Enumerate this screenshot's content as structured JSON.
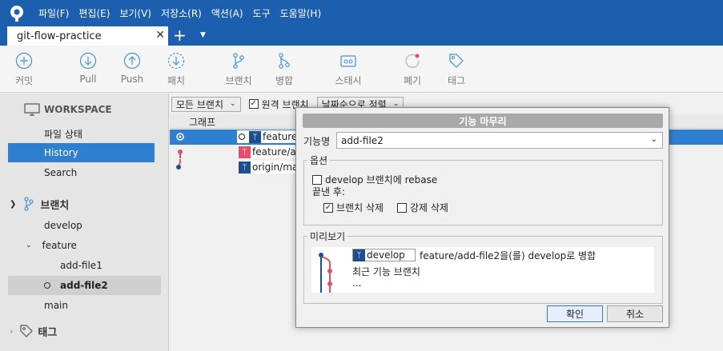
{
  "menu": [
    "파일(F)",
    "편집(E)",
    "보기(V)",
    "저장소(R)",
    "액션(A)",
    "도구",
    "도움말(H)"
  ],
  "tab": {
    "title": "git-flow-practice",
    "close": "✕",
    "add": "+",
    "menu": "▼"
  },
  "toolbar": {
    "commit": "커밋",
    "pull": "Pull",
    "push": "Push",
    "fetch": "패치",
    "branch": "브랜치",
    "merge": "병합",
    "stash": "스태시",
    "discard": "폐기",
    "tag": "태그"
  },
  "sidebar": {
    "workspace": "WORKSPACE",
    "file_status": "파일 상태",
    "history": "History",
    "search": "Search",
    "branches": "브랜치",
    "develop": "develop",
    "feature": "feature",
    "add_file1": "add-file1",
    "add_file2": "add-file2",
    "main": "main",
    "tags": "태그"
  },
  "filter": {
    "all_branches": "모든 브랜치",
    "remote_branch": "원격 브랜치",
    "sort": "날짜순으로 정렬"
  },
  "columns": {
    "graph": "그래프"
  },
  "refs": [
    "feature",
    "feature/ad",
    "origin/ma"
  ],
  "dialog": {
    "title": "기능 마무리",
    "feature_name_label": "기능명",
    "feature_name_value": "add-file2",
    "options_label": "옵션",
    "rebase_option": "develop 브랜치에 rebase",
    "after_label": "끝낸 후:",
    "delete_branch": "브랜치 삭제",
    "force_delete": "강제 삭제",
    "preview_label": "미리보기",
    "preview_branch": "develop",
    "preview_line1": "feature/add-file2을(를) develop로 병합",
    "preview_line2": "최근 기능 브랜치",
    "preview_line3": "...",
    "ok": "확인",
    "cancel": "취소"
  },
  "colors": {
    "accent": "#1b5fae",
    "selection": "#2f7fd1",
    "branch_blue": "#1f4e8c",
    "branch_pink": "#e0506a"
  }
}
